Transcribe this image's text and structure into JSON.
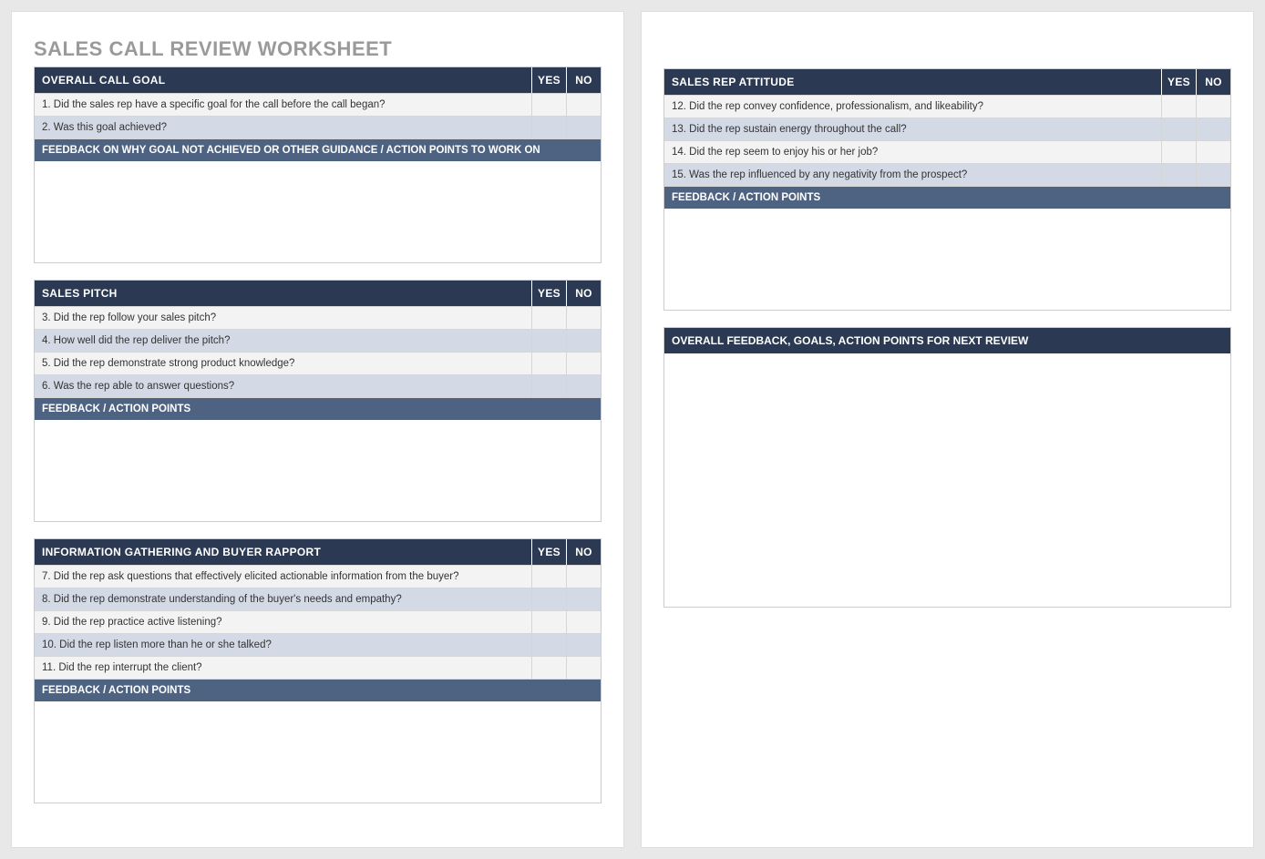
{
  "title": "SALES CALL REVIEW WORKSHEET",
  "columns": {
    "yes": "YES",
    "no": "NO"
  },
  "sections": {
    "overall_goal": {
      "header": "OVERALL CALL GOAL",
      "rows": [
        "1.  Did the sales rep have a specific goal for the call before the call began?",
        "2. Was this goal achieved?"
      ],
      "feedback_header": "FEEDBACK ON WHY GOAL NOT ACHIEVED OR OTHER GUIDANCE / ACTION POINTS TO WORK ON",
      "feedback_value": ""
    },
    "sales_pitch": {
      "header": "SALES PITCH",
      "rows": [
        "3. Did the rep follow your sales pitch?",
        "4. How well did the rep deliver the pitch?",
        "5. Did the rep demonstrate strong product knowledge?",
        "6. Was the rep able to answer questions?"
      ],
      "feedback_header": "FEEDBACK / ACTION POINTS",
      "feedback_value": ""
    },
    "info_gathering": {
      "header": "INFORMATION GATHERING AND BUYER RAPPORT",
      "rows": [
        "7. Did the rep ask questions that effectively elicited actionable information from the buyer?",
        "8. Did the rep demonstrate understanding of the buyer's needs and empathy?",
        "9. Did the rep practice active listening?",
        "10. Did the rep listen more than he or she talked?",
        "11. Did the rep interrupt the client?"
      ],
      "feedback_header": "FEEDBACK / ACTION POINTS",
      "feedback_value": ""
    },
    "attitude": {
      "header": "SALES REP ATTITUDE",
      "rows": [
        "12. Did the rep convey confidence, professionalism, and likeability?",
        "13. Did the rep sustain energy throughout the call?",
        "14. Did the rep seem to enjoy his or her job?",
        "15. Was the rep influenced by any negativity from the prospect?"
      ],
      "feedback_header": "FEEDBACK / ACTION POINTS",
      "feedback_value": ""
    },
    "overall_feedback": {
      "header": "OVERALL FEEDBACK, GOALS, ACTION POINTS FOR NEXT REVIEW",
      "value": ""
    }
  }
}
